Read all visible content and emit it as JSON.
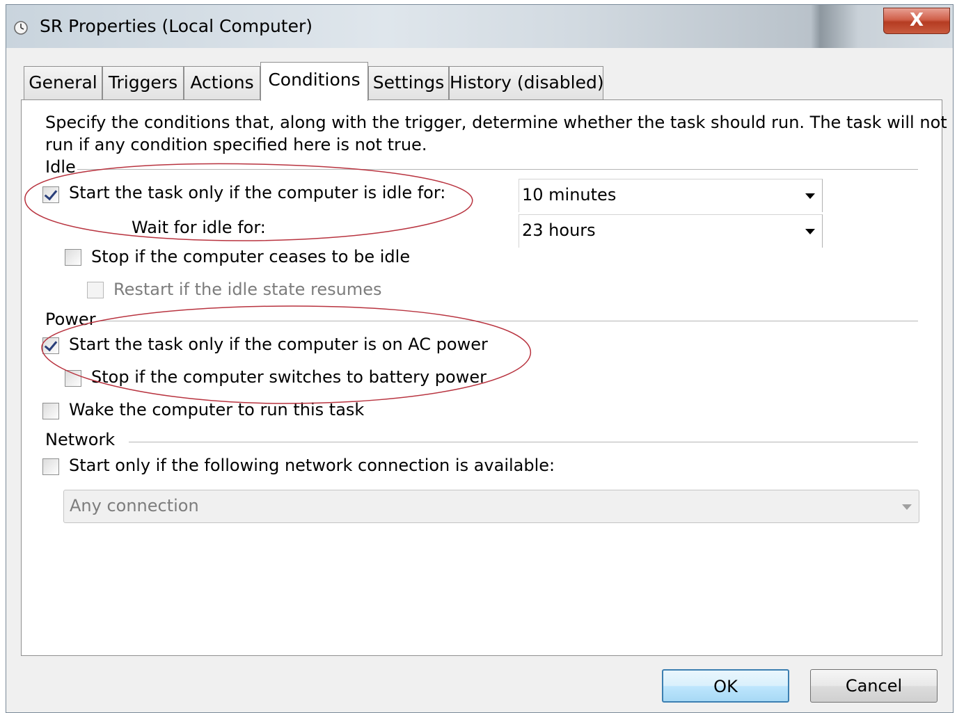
{
  "window": {
    "title": "SR Properties (Local Computer)",
    "close_glyph": "X"
  },
  "tabs": [
    {
      "label": "General"
    },
    {
      "label": "Triggers"
    },
    {
      "label": "Actions"
    },
    {
      "label": "Conditions"
    },
    {
      "label": "Settings"
    },
    {
      "label": "History (disabled)"
    }
  ],
  "active_tab": "Conditions",
  "description": {
    "line1": "Specify the conditions that, along with the trigger, determine whether the task should run.  The task will not",
    "line2": "run  if any condition specified here is not true."
  },
  "idle": {
    "group_label": "Idle",
    "start_if_idle": {
      "label": "Start the task only if the computer is idle for:",
      "checked": true
    },
    "idle_duration": "10 minutes",
    "wait_label": "Wait for idle for:",
    "wait_duration": "23 hours",
    "stop_if_not_idle": {
      "label": "Stop if the computer ceases to be idle",
      "checked": false
    },
    "restart_if_idle": {
      "label": "Restart if the idle state resumes",
      "checked": false
    }
  },
  "power": {
    "group_label": "Power",
    "ac_power": {
      "label": "Start the task only if the computer is on AC power",
      "checked": true
    },
    "stop_on_battery": {
      "label": "Stop if the computer switches to battery power",
      "checked": false
    },
    "wake": {
      "label": "Wake the computer to run this task",
      "checked": false
    }
  },
  "network": {
    "group_label": "Network",
    "start_if_network": {
      "label": "Start only if the following network connection is available:",
      "checked": false
    },
    "connection": "Any connection"
  },
  "buttons": {
    "ok": "OK",
    "cancel": "Cancel"
  },
  "colors": {
    "annotation": "#b8333f",
    "default_button_border": "#3c7fb1"
  }
}
